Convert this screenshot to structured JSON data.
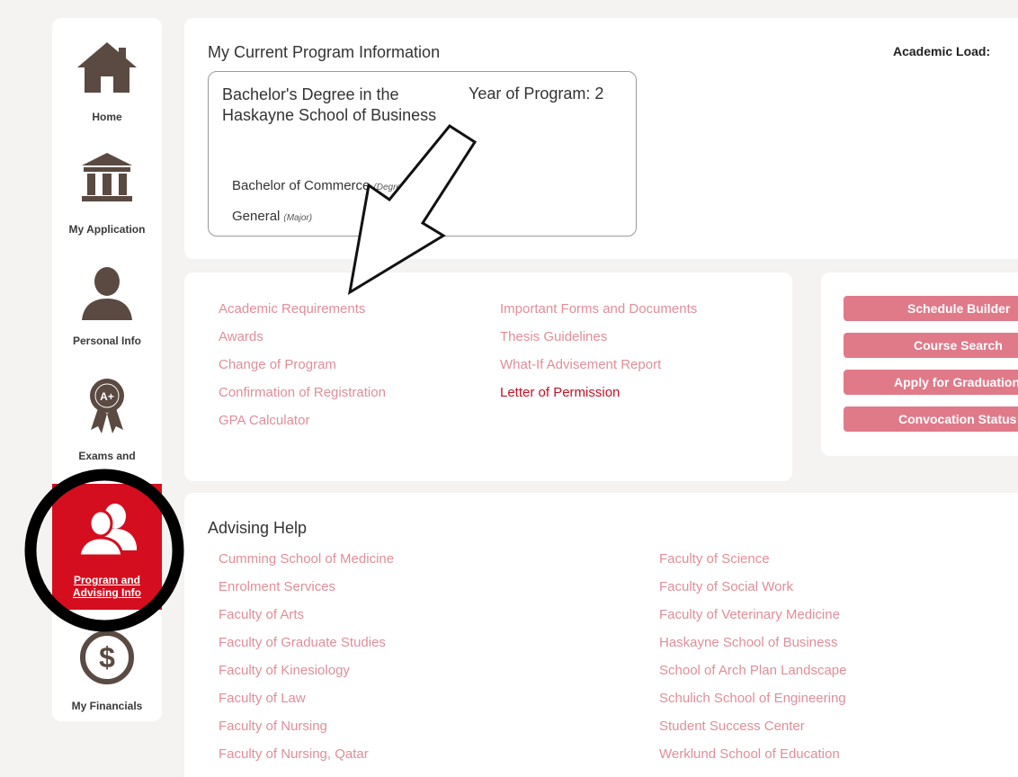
{
  "sidebar": {
    "items": [
      {
        "label": "Home",
        "icon": "house-icon"
      },
      {
        "label": "My Application",
        "icon": "bank-building-icon"
      },
      {
        "label": "Personal Info",
        "icon": "person-icon"
      },
      {
        "label": "Exams and",
        "icon": "award-ribbon-icon"
      },
      {
        "label_line1": "Program and",
        "label_line2": "Advising Info",
        "icon": "users-icon",
        "active": true
      },
      {
        "label": "My Financials",
        "icon": "dollar-circle-icon"
      }
    ]
  },
  "program": {
    "title": "My Current Program Information",
    "academic_load_label": "Academic Load:",
    "degree": "Bachelor's Degree in the Haskayne School of Business",
    "year_label": "Year of Program: 2",
    "stream_name": "Bachelor of Commerce",
    "stream_tag": "(Degree Stream)",
    "major_name": "General",
    "major_tag": "(Major)"
  },
  "links": {
    "col1": [
      "Academic Requirements",
      "Awards",
      "Change of Program",
      "Confirmation of Registration",
      "GPA Calculator"
    ],
    "col2": [
      "Important Forms and Documents",
      "Thesis Guidelines",
      "What-If Advisement Report",
      "Letter of Permission"
    ]
  },
  "buttons": [
    "Schedule Builder",
    "Course Search",
    "Apply for Graduation",
    "Convocation Status"
  ],
  "advising": {
    "title": "Advising Help",
    "col1": [
      "Cumming School of Medicine",
      "Enrolment Services",
      "Faculty of Arts",
      "Faculty of Graduate Studies",
      "Faculty of Kinesiology",
      "Faculty of Law",
      "Faculty of Nursing",
      "Faculty of Nursing, Qatar"
    ],
    "col2": [
      "Faculty of Science",
      "Faculty of Social Work",
      "Faculty of Veterinary Medicine",
      "Haskayne School of Business",
      "School of Arch Plan Landscape",
      "Schulich School of Engineering",
      "Student Success Center",
      "Werklund School of Education"
    ]
  },
  "colors": {
    "brand_red": "#d40e1f",
    "link_pink": "#e08e99",
    "button_pink": "#e07a89",
    "icon_brown": "#5a4a42"
  }
}
